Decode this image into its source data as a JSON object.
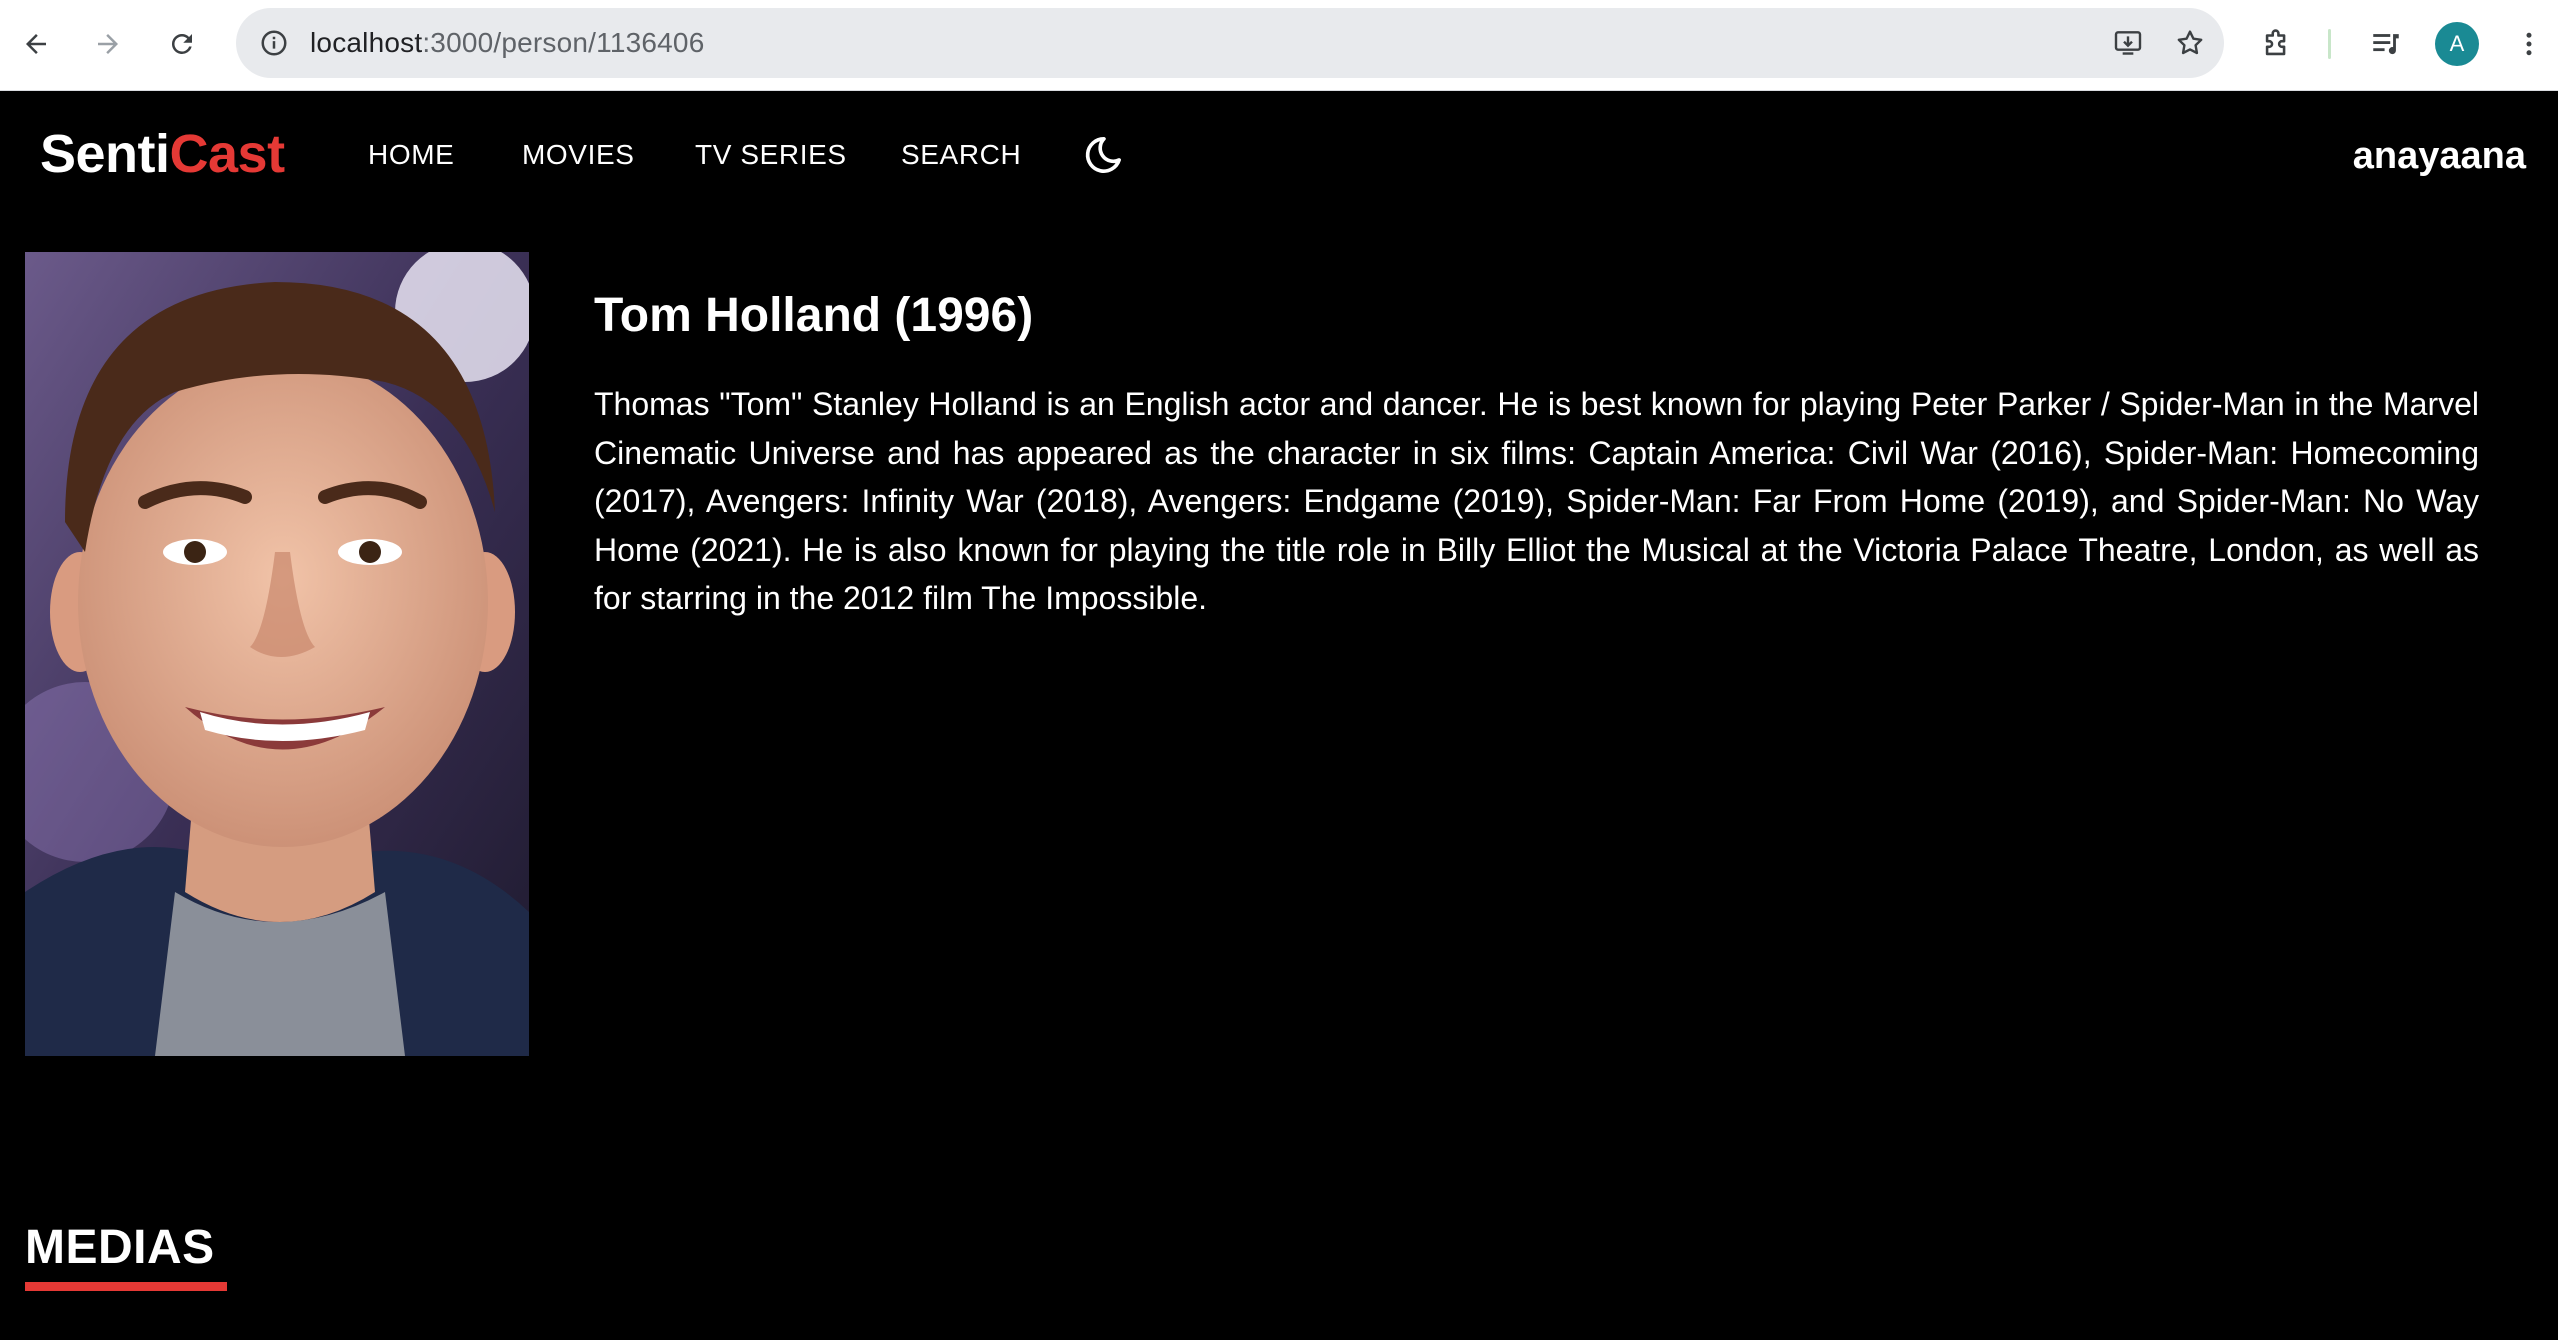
{
  "browser": {
    "url_host": "localhost",
    "url_path": ":3000/person/1136406",
    "avatar_letter": "A",
    "icons": [
      "back-icon",
      "forward-icon",
      "reload-icon",
      "site-info-icon",
      "install-icon",
      "bookmark-star-icon",
      "extensions-icon",
      "media-controls-icon",
      "profile-avatar",
      "more-menu-icon"
    ]
  },
  "header": {
    "logo_part1": "Senti",
    "logo_part2": "Cast",
    "nav": {
      "home": "HOME",
      "movies": "MOVIES",
      "tv_series": "TV SERIES",
      "search": "SEARCH"
    },
    "theme_icon": "moon-icon",
    "username": "anayaana"
  },
  "person": {
    "title": "Tom Holland (1996)",
    "bio": "Thomas \"Tom\" Stanley Holland is an English actor and dancer. He is best known for playing Peter Parker / Spider-Man in the Marvel Cinematic Universe and has appeared as the character in six films: Captain America: Civil War (2016), Spider-Man: Homecoming (2017), Avengers: Infinity War (2018), Avengers: Endgame (2019), Spider-Man: Far From Home (2019), and Spider-Man: No Way Home (2021). He is also known for playing the title role in Billy Elliot the Musical at the Victoria Palace Theatre, London, as well as for starring in the 2012 film The Impossible."
  },
  "medias": {
    "heading": "MEDIAS"
  },
  "colors": {
    "accent": "#e53935",
    "background": "#000000",
    "text": "#ffffff"
  }
}
